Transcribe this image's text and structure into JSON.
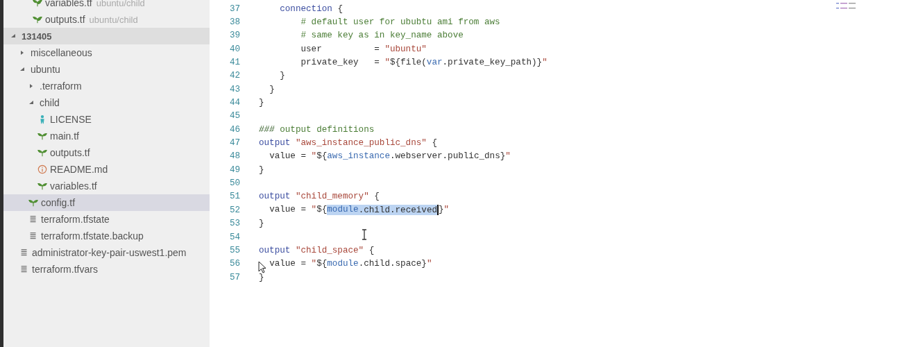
{
  "sidebar": {
    "open_files": [
      {
        "name": "variables.tf",
        "path": "ubuntu/child",
        "kind": "terraform"
      },
      {
        "name": "outputs.tf",
        "path": "ubuntu/child",
        "kind": "terraform"
      }
    ],
    "tree": [
      {
        "name": "131405",
        "kind": "root",
        "expanded": true,
        "children": [
          {
            "name": "miscellaneous",
            "kind": "folder",
            "expanded": false,
            "selected": false
          },
          {
            "name": "ubuntu",
            "kind": "folder",
            "expanded": true,
            "selected": false,
            "children": [
              {
                "name": ".terraform",
                "kind": "folder",
                "expanded": false,
                "selected": false
              },
              {
                "name": "child",
                "kind": "folder",
                "expanded": true,
                "selected": false,
                "children": [
                  {
                    "name": "LICENSE",
                    "kind": "license",
                    "selected": false
                  },
                  {
                    "name": "main.tf",
                    "kind": "terraform",
                    "selected": false
                  },
                  {
                    "name": "outputs.tf",
                    "kind": "terraform",
                    "selected": false
                  },
                  {
                    "name": "README.md",
                    "kind": "info",
                    "selected": false
                  },
                  {
                    "name": "variables.tf",
                    "kind": "terraform",
                    "selected": false
                  }
                ]
              },
              {
                "name": "config.tf",
                "kind": "terraform",
                "selected": true
              },
              {
                "name": "terraform.tfstate",
                "kind": "text",
                "selected": false
              },
              {
                "name": "terraform.tfstate.backup",
                "kind": "text",
                "selected": false
              }
            ]
          },
          {
            "name": "administrator-key-pair-uswest1.pem",
            "kind": "text",
            "selected": false
          },
          {
            "name": "terraform.tfvars",
            "kind": "text",
            "selected": false
          }
        ]
      }
    ]
  },
  "editor": {
    "lines": [
      {
        "number": "37",
        "tokens": [
          {
            "text": "    connection",
            "kind": "keyword",
            "selected": false
          },
          {
            "text": " {",
            "kind": "plain",
            "selected": false
          }
        ]
      },
      {
        "number": "38",
        "tokens": [
          {
            "text": "        # default user for ububtu ami from aws",
            "kind": "comment",
            "selected": false
          }
        ]
      },
      {
        "number": "39",
        "tokens": [
          {
            "text": "        # same key as in key_name above",
            "kind": "comment",
            "selected": false
          }
        ]
      },
      {
        "number": "40",
        "tokens": [
          {
            "text": "        user          = ",
            "kind": "plain",
            "selected": false
          },
          {
            "text": "\"ubuntu\"",
            "kind": "string",
            "selected": false
          }
        ]
      },
      {
        "number": "41",
        "tokens": [
          {
            "text": "        private_key   = ",
            "kind": "plain",
            "selected": false
          },
          {
            "text": "\"",
            "kind": "string",
            "selected": false
          },
          {
            "text": "${file(",
            "kind": "plain",
            "selected": false
          },
          {
            "text": "var",
            "kind": "variable",
            "selected": false
          },
          {
            "text": ".private_key_path)}",
            "kind": "plain",
            "selected": false
          },
          {
            "text": "\"",
            "kind": "string",
            "selected": false
          }
        ]
      },
      {
        "number": "42",
        "tokens": [
          {
            "text": "    }",
            "kind": "plain",
            "selected": false
          }
        ]
      },
      {
        "number": "43",
        "tokens": [
          {
            "text": "  }",
            "kind": "plain",
            "selected": false
          }
        ]
      },
      {
        "number": "44",
        "tokens": [
          {
            "text": "}",
            "kind": "plain",
            "selected": false
          }
        ]
      },
      {
        "number": "45"
      },
      {
        "number": "46",
        "tokens": [
          {
            "text": "###",
            "kind": "comment-mark",
            "selected": false
          },
          {
            "text": " output definitions",
            "kind": "comment",
            "selected": false
          }
        ]
      },
      {
        "number": "47",
        "tokens": [
          {
            "text": "output ",
            "kind": "keyword",
            "selected": false
          },
          {
            "text": "\"aws_instance_public_dns\"",
            "kind": "string",
            "selected": false
          },
          {
            "text": " {",
            "kind": "plain",
            "selected": false
          }
        ]
      },
      {
        "number": "48",
        "tokens": [
          {
            "text": "  value = ",
            "kind": "plain",
            "selected": false
          },
          {
            "text": "\"",
            "kind": "string",
            "selected": false
          },
          {
            "text": "${",
            "kind": "plain",
            "selected": false
          },
          {
            "text": "aws_instance",
            "kind": "variable",
            "selected": false
          },
          {
            "text": ".webserver.public_dns}",
            "kind": "plain",
            "selected": false
          },
          {
            "text": "\"",
            "kind": "string",
            "selected": false
          }
        ]
      },
      {
        "number": "49",
        "tokens": [
          {
            "text": "}",
            "kind": "plain",
            "selected": false
          }
        ]
      },
      {
        "number": "50"
      },
      {
        "number": "51",
        "tokens": [
          {
            "text": "output ",
            "kind": "keyword",
            "selected": false
          },
          {
            "text": "\"child_memory\"",
            "kind": "string",
            "selected": false
          },
          {
            "text": " {",
            "kind": "plain",
            "selected": false
          }
        ]
      },
      {
        "number": "52",
        "tokens": [
          {
            "text": "  value = ",
            "kind": "plain",
            "selected": false
          },
          {
            "text": "\"",
            "kind": "string",
            "selected": false
          },
          {
            "text": "${",
            "kind": "plain",
            "selected": false
          },
          {
            "text": "module",
            "kind": "variable",
            "selected": true
          },
          {
            "text": ".child.received",
            "kind": "plain",
            "selected": true,
            "caret_after": true
          },
          {
            "text": "}",
            "kind": "plain",
            "selected": false
          },
          {
            "text": "\"",
            "kind": "string",
            "selected": false
          }
        ]
      },
      {
        "number": "53",
        "tokens": [
          {
            "text": "}",
            "kind": "plain",
            "selected": false
          }
        ]
      },
      {
        "number": "54"
      },
      {
        "number": "55",
        "tokens": [
          {
            "text": "output ",
            "kind": "keyword",
            "selected": false
          },
          {
            "text": "\"child_space\"",
            "kind": "string",
            "selected": false
          },
          {
            "text": " {",
            "kind": "plain",
            "selected": false
          }
        ]
      },
      {
        "number": "56",
        "tokens": [
          {
            "text": "  value = ",
            "kind": "plain",
            "selected": false
          },
          {
            "text": "\"",
            "kind": "string",
            "selected": false
          },
          {
            "text": "${",
            "kind": "plain",
            "selected": false
          },
          {
            "text": "module",
            "kind": "variable",
            "selected": false
          },
          {
            "text": ".child.space}",
            "kind": "plain",
            "selected": false
          },
          {
            "text": "\"",
            "kind": "string",
            "selected": false
          }
        ]
      },
      {
        "number": "57",
        "tokens": [
          {
            "text": "}",
            "kind": "plain",
            "selected": false
          }
        ]
      }
    ]
  }
}
